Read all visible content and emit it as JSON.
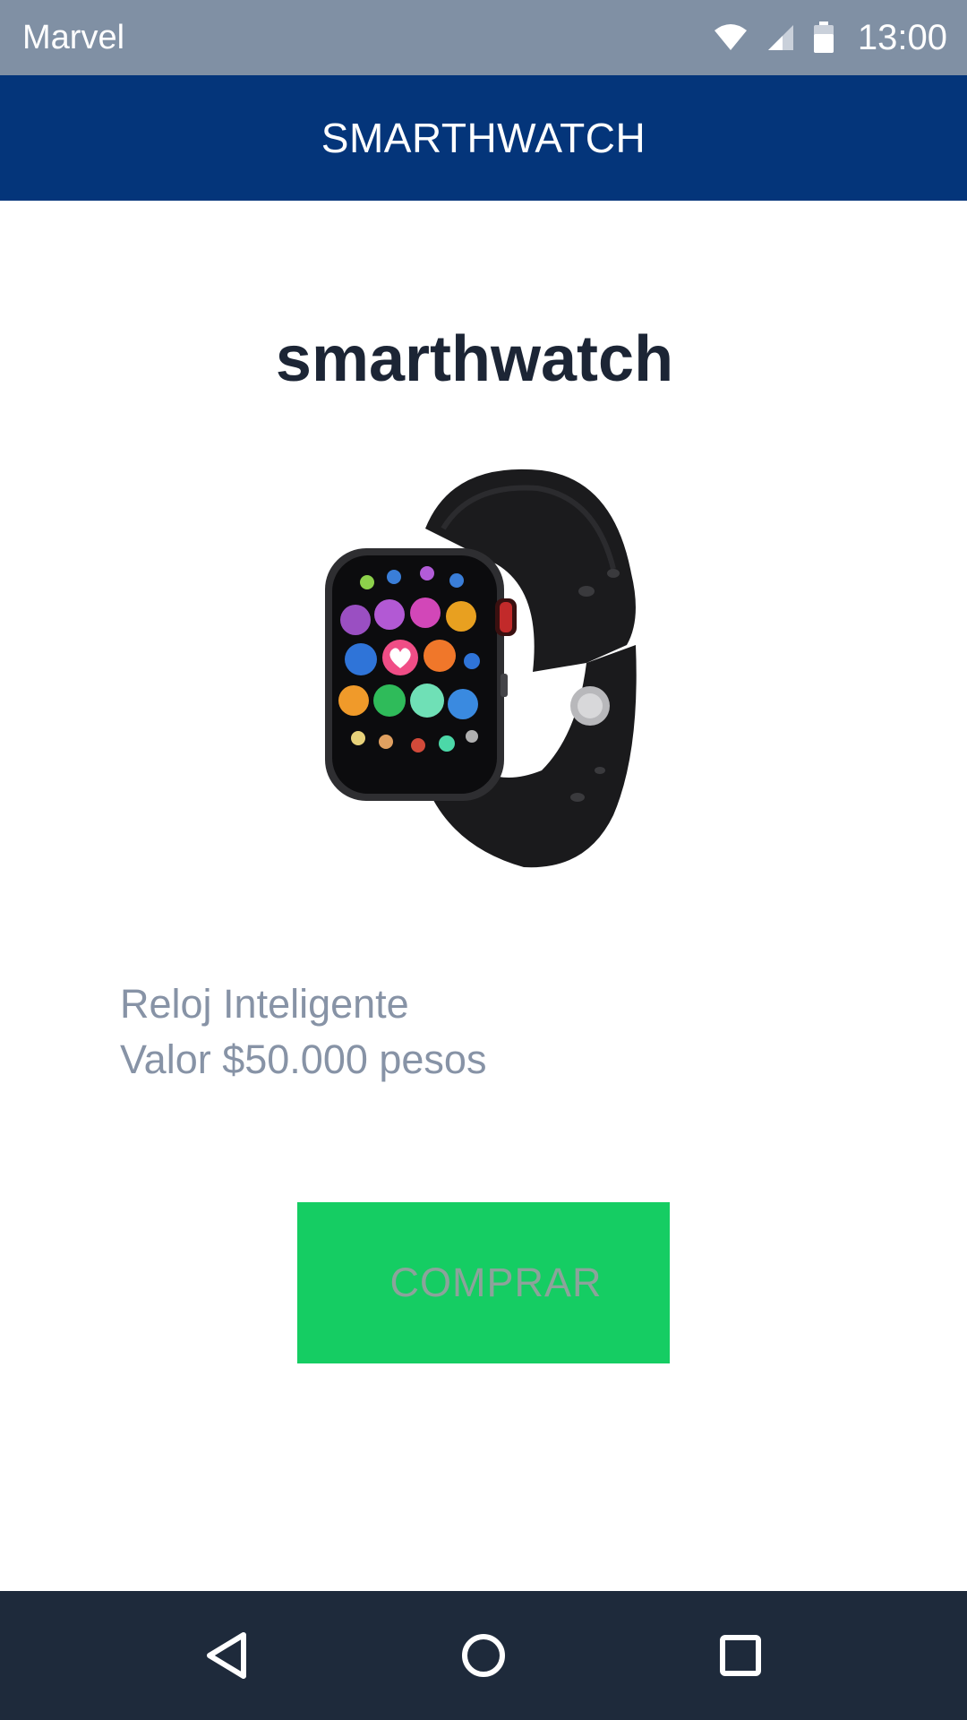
{
  "status_bar": {
    "app_name": "Marvel",
    "time": "13:00",
    "icons": [
      "wifi-icon",
      "signal-icon",
      "battery-icon"
    ]
  },
  "app_bar": {
    "title": "SMARTHWATCH"
  },
  "product": {
    "title": "smarthwatch",
    "image": "smartwatch-image",
    "description_line1": "Reloj Inteligente",
    "description_line2": "Valor $50.000 pesos"
  },
  "buy_button": {
    "label": "COMPRAR"
  },
  "nav_bar": {
    "icons": [
      "back-icon",
      "home-icon",
      "recents-icon"
    ]
  },
  "colors": {
    "status_bar": "#8090a4",
    "app_bar": "#04357a",
    "button": "#15cd63",
    "button_text": "#8ca39b",
    "nav_bar": "#1e2a3b",
    "title_text": "#1c2535",
    "desc_text": "#8793a6"
  }
}
